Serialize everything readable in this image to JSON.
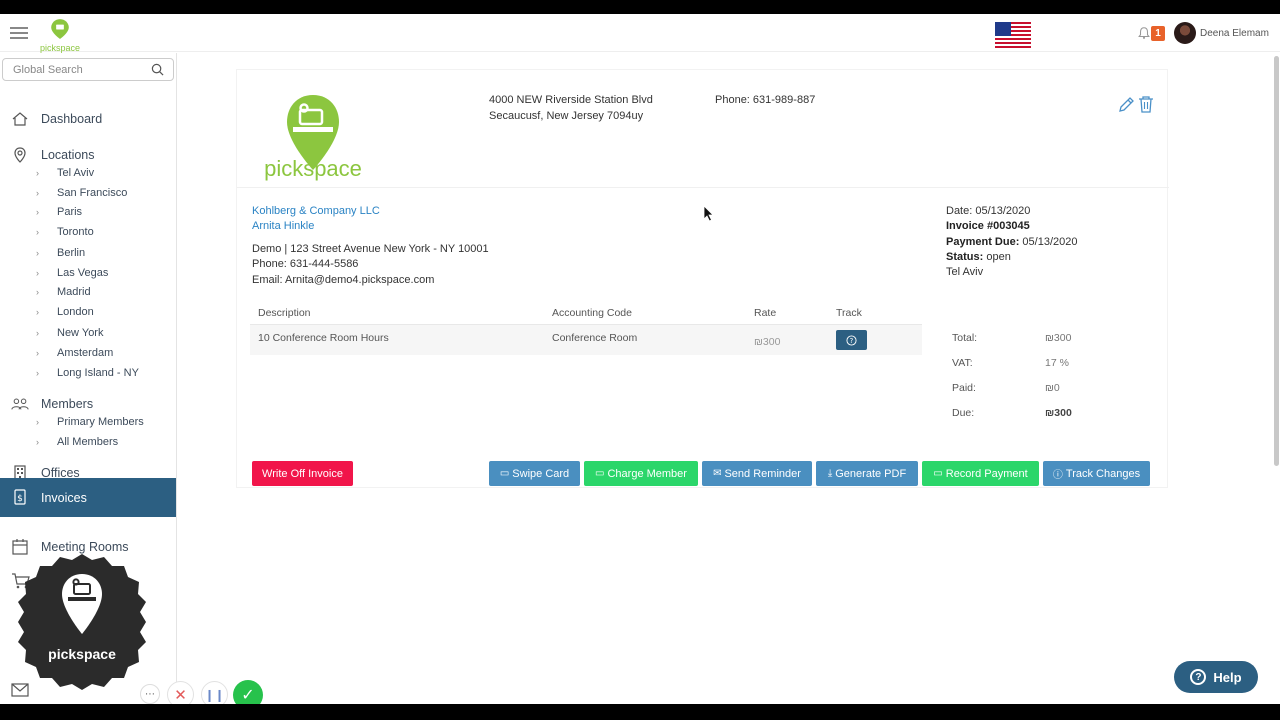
{
  "topbar": {
    "logo_word": "pickspace",
    "notification_count": "1",
    "user_name": "Deena Elemam"
  },
  "sidebar": {
    "search_placeholder": "Global Search",
    "dashboard": "Dashboard",
    "locations": "Locations",
    "location_items": [
      "Tel Aviv",
      "San Francisco",
      "Paris",
      "Toronto",
      "Berlin",
      "Las Vegas",
      "Madrid",
      "London",
      "New York",
      "Amsterdam",
      "Long Island - NY"
    ],
    "members": "Members",
    "member_items": [
      "Primary Members",
      "All Members"
    ],
    "offices": "Offices",
    "invoices": "Invoices",
    "meeting_rooms": "Meeting Rooms"
  },
  "overlay": {
    "logo_word": "pickspace"
  },
  "invoice": {
    "logo_word": "pickspace",
    "address_line1": "4000 NEW Riverside Station Blvd",
    "address_line2": "Secaucusf, New Jersey 7094uy",
    "phone": "Phone: 631-989-887",
    "customer": {
      "company": "Kohlberg & Company LLC",
      "name": "Arnita Hinkle",
      "address": "Demo | 123 Street Avenue New York - NY 10001",
      "phone": "Phone: 631-444-5586",
      "email": "Email: Arnita@demo4.pickspace.com"
    },
    "meta": {
      "date": "Date: 05/13/2020",
      "invoice_number": "Invoice #003045",
      "payment_due_label": "Payment Due:",
      "payment_due_value": " 05/13/2020",
      "status_label": "Status:",
      "status_value": " open",
      "location": "Tel Aviv"
    },
    "table": {
      "headers": {
        "description": "Description",
        "accounting_code": "Accounting Code",
        "rate": "Rate",
        "track": "Track"
      },
      "rows": [
        {
          "description": "10 Conference Room Hours",
          "accounting_code": "Conference Room",
          "rate": "₪300"
        }
      ]
    },
    "totals": {
      "total_label": "Total:",
      "total_value": "₪300",
      "vat_label": "VAT:",
      "vat_value": "17 %",
      "paid_label": "Paid:",
      "paid_value": "₪0",
      "due_label": "Due:",
      "due_value": "₪300"
    },
    "actions": {
      "write_off": "Write Off Invoice",
      "swipe_card": "Swipe Card",
      "charge_member": "Charge Member",
      "send_reminder": "Send Reminder",
      "generate_pdf": "Generate PDF",
      "record_payment": "Record Payment",
      "track_changes": "Track Changes"
    }
  },
  "help": {
    "label": "Help"
  },
  "colors": {
    "brand_green": "#8cc63f",
    "nav_active": "#2c5f82",
    "link_blue": "#2a83c4",
    "danger": "#f1154a",
    "action_blue": "#4a8fc0",
    "action_green": "#2bd66a"
  }
}
